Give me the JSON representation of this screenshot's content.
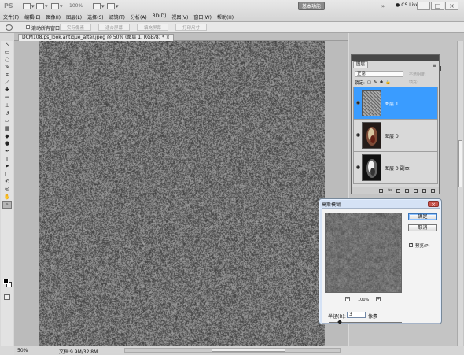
{
  "app": {
    "logo": "PS",
    "zoom_toolbar_value": "100%",
    "workspace_label": "基本功能",
    "cs_live_label": "CS Live",
    "window_buttons": [
      "−",
      "□",
      "×"
    ]
  },
  "menu": [
    "文件(F)",
    "编辑(E)",
    "图像(I)",
    "图层(L)",
    "选择(S)",
    "滤镜(T)",
    "分析(A)",
    "3D(D)",
    "视图(V)",
    "窗口(W)",
    "帮助(H)"
  ],
  "options_bar": {
    "scroll_all_label": "滚动所有窗口",
    "buttons": [
      "实际像素",
      "适合屏幕",
      "填充屏幕",
      "打印尺寸"
    ]
  },
  "document": {
    "tab_title": "DCM108.ps_look.antique_after.jpeg @ 50% (图层 1, RGB/8) * ×",
    "status_zoom": "50%",
    "status_doc": "文档:9.9M/32.8M"
  },
  "layers_panel": {
    "title": "图层",
    "blend_mode": "正常",
    "opacity_label": "不透明度:",
    "fill_label": "填充:",
    "lock_label": "锁定:",
    "layers": [
      {
        "name": "图层 1",
        "selected": true,
        "thumb": "noise"
      },
      {
        "name": "图层 0",
        "selected": false,
        "thumb": "egg"
      },
      {
        "name": "图层 0 副本",
        "selected": false,
        "thumb": "egg"
      }
    ],
    "bottom_icons": [
      "link-icon",
      "fx-icon",
      "mask-icon",
      "adjustment-icon",
      "folder-icon",
      "new-layer-icon",
      "trash-icon"
    ]
  },
  "dialog": {
    "title": "高斯模糊",
    "ok_label": "确定",
    "cancel_label": "取消",
    "preview_label": "预览(P)",
    "preview_checked": true,
    "zoom_value": "100%",
    "radius_label": "半径(R):",
    "radius_value": "3",
    "radius_unit": "像素",
    "radius_slider_fraction": 0.03
  },
  "colors": {
    "selected_layer": "#3a9cff",
    "dialog_frame": "#d5e2f5",
    "close_button": "#c7534d",
    "workspace_button": "#8a8a8a"
  },
  "tools": [
    "move-icon",
    "marquee-icon",
    "lasso-icon",
    "quick-select-icon",
    "crop-icon",
    "eyedropper-icon",
    "spot-heal-icon",
    "brush-icon",
    "clone-stamp-icon",
    "history-brush-icon",
    "eraser-icon",
    "gradient-icon",
    "blur-icon",
    "dodge-icon",
    "pen-icon",
    "type-icon",
    "path-select-icon",
    "shape-icon",
    "3d-rotate-icon",
    "3d-orbit-icon",
    "hand-icon",
    "zoom-icon"
  ]
}
